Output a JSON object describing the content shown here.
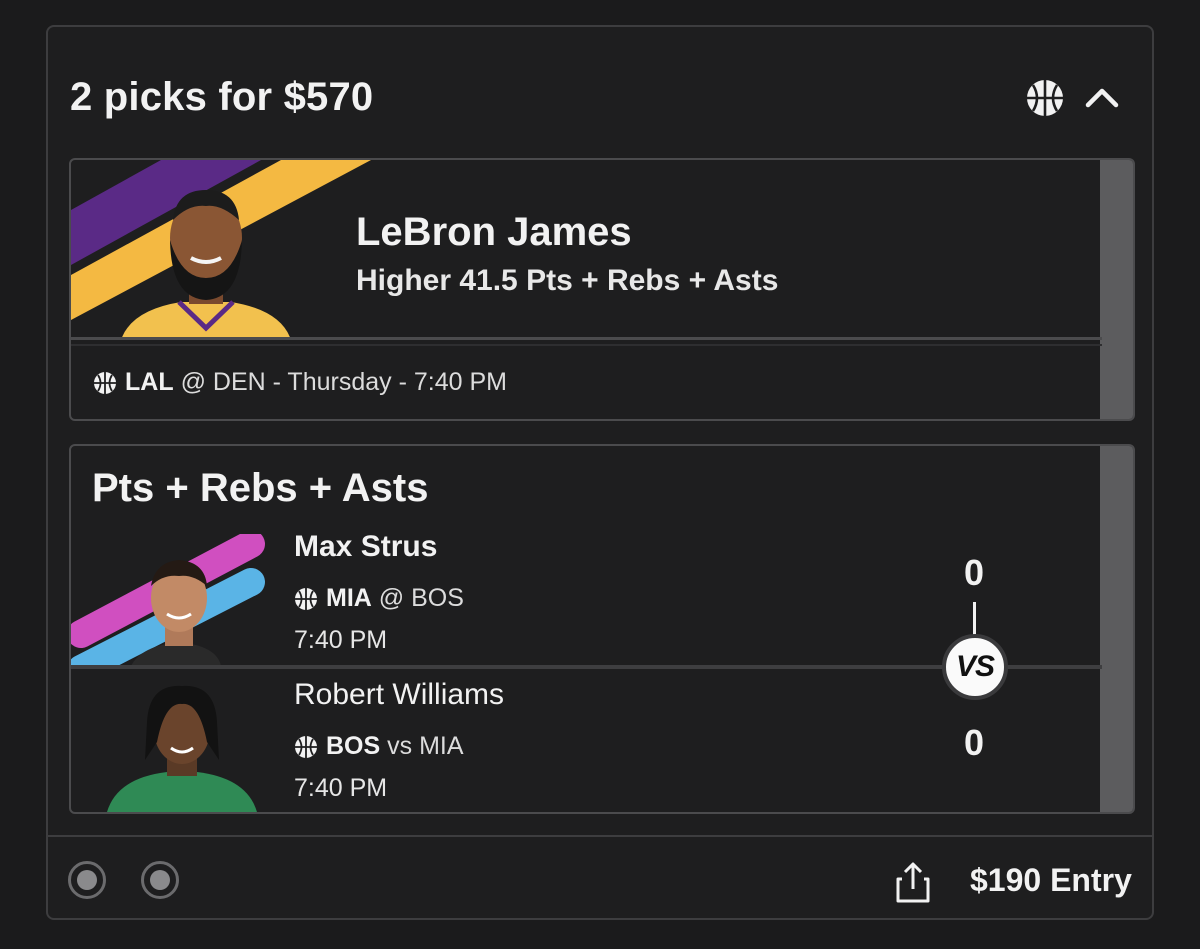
{
  "header": {
    "title": "2 picks for $570"
  },
  "pick1": {
    "player": "LeBron James",
    "projection": "Higher 41.5 Pts + Rebs + Asts",
    "team": "LAL",
    "matchup_rest": "@ DEN - Thursday - 7:40 PM",
    "colors": [
      "#5a2a86",
      "#f4b942"
    ]
  },
  "pick2": {
    "stat": "Pts + Rebs + Asts",
    "player_a": {
      "name": "Max Strus",
      "team": "MIA",
      "matchup_rest": "@ BOS",
      "time": "7:40 PM",
      "score": "0",
      "colors": [
        "#d04fc0",
        "#5ab4e6"
      ]
    },
    "player_b": {
      "name": "Robert Williams",
      "team": "BOS",
      "matchup_rest": "vs MIA",
      "time": "7:40 PM",
      "score": "0"
    },
    "vs_label": "VS"
  },
  "footer": {
    "entry_label": "$190 Entry"
  }
}
